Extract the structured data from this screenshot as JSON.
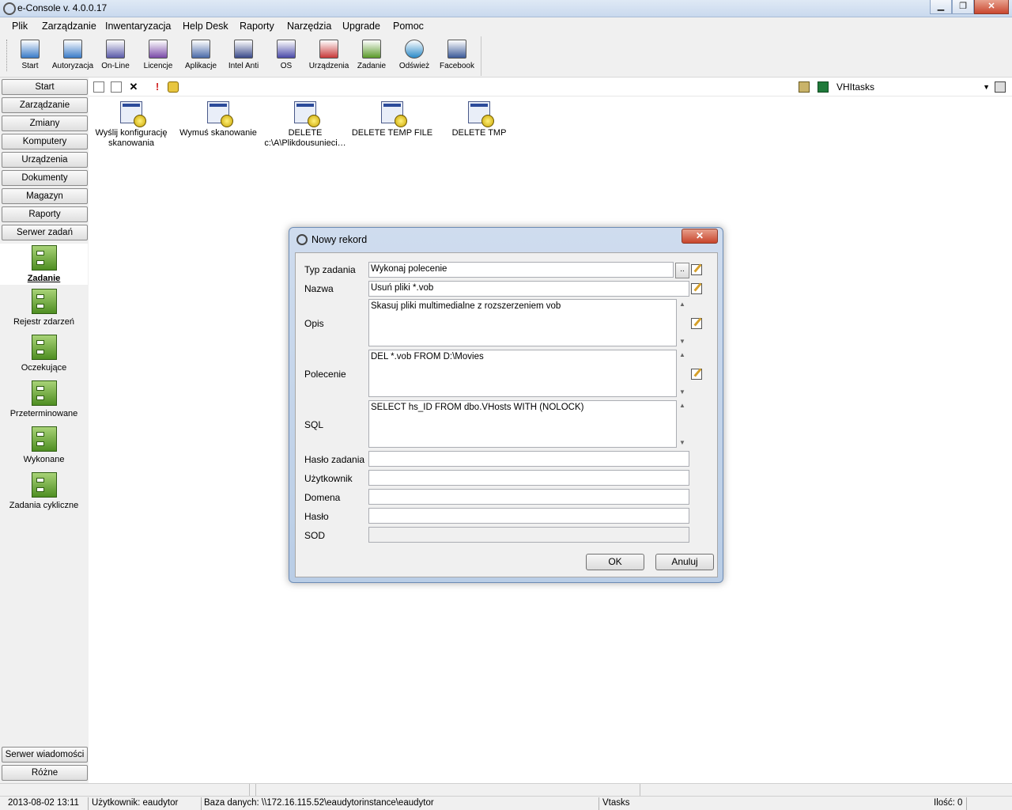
{
  "window": {
    "title": "e-Console v. 4.0.0.17",
    "minimize": "▁",
    "restore": "❐",
    "close": "✕"
  },
  "menu": [
    "Plik",
    "Zarządzanie",
    "Inwentaryzacja",
    "Help Desk",
    "Raporty",
    "Narzędzia",
    "Upgrade",
    "Pomoc"
  ],
  "toolbar": [
    {
      "label": "Start",
      "icon": "start-icon",
      "color": "#3a7bc8"
    },
    {
      "label": "Autoryzacja",
      "icon": "authorization-icon",
      "color": "#3a7bc8"
    },
    {
      "label": "On-Line",
      "icon": "online-icon",
      "color": "#5a5aa8"
    },
    {
      "label": "Licencje",
      "icon": "licenses-icon",
      "color": "#7a4aa8"
    },
    {
      "label": "Aplikacje",
      "icon": "applications-icon",
      "color": "#4a6aa8"
    },
    {
      "label": "Intel Anti",
      "icon": "intel-anti-icon",
      "color": "#3a4a8a"
    },
    {
      "label": "OS",
      "icon": "os-icon",
      "color": "#4a4aa8"
    },
    {
      "label": "Urządzenia",
      "icon": "devices-icon",
      "color": "#c83a3a"
    },
    {
      "label": "Zadanie",
      "icon": "task-icon",
      "color": "#5a9a2a"
    },
    {
      "label": "Odśwież",
      "icon": "refresh-icon",
      "color": "#2a8ac8"
    },
    {
      "label": "Facebook",
      "icon": "facebook-icon",
      "color": "#3b5998"
    }
  ],
  "sidebar": {
    "nav": [
      "Start",
      "Zarządzanie",
      "Zmiany",
      "Komputery",
      "Urządzenia",
      "Dokumenty",
      "Magazyn",
      "Raporty",
      "Serwer zadań"
    ],
    "items": [
      {
        "label": "Zadanie",
        "icon": "task-list-icon",
        "active": true
      },
      {
        "label": "Rejestr zdarzeń",
        "icon": "event-log-icon"
      },
      {
        "label": "Oczekujące",
        "icon": "pending-icon"
      },
      {
        "label": "Przeterminowane",
        "icon": "expired-icon"
      },
      {
        "label": "Wykonane",
        "icon": "completed-icon"
      },
      {
        "label": "Zadania cykliczne",
        "icon": "recurring-tasks-icon"
      }
    ],
    "bottom": [
      "Serwer wiadomości",
      "Różne"
    ]
  },
  "content_toolbar": {
    "combo_value": "VHItasks"
  },
  "tasks": [
    {
      "line1": "Wyślij konfigurację",
      "line2": "skanowania"
    },
    {
      "line1": "Wymuś skanowanie",
      "line2": ""
    },
    {
      "line1": "DELETE",
      "line2": "c:\\A\\Plikdousunieci…"
    },
    {
      "line1": "DELETE TEMP FILE",
      "line2": ""
    },
    {
      "line1": "DELETE TMP",
      "line2": ""
    }
  ],
  "dialog": {
    "title": "Nowy rekord",
    "close": "✕",
    "fields": {
      "typ": {
        "label": "Typ zadania",
        "value": "Wykonaj polecenie"
      },
      "nazwa": {
        "label": "Nazwa",
        "value": "Usuń pliki *.vob"
      },
      "opis": {
        "label": "Opis",
        "value": "Skasuj pliki multimedialne z rozszerzeniem vob"
      },
      "polecenie": {
        "label": "Polecenie",
        "value": "DEL *.vob FROM D:\\Movies"
      },
      "sql": {
        "label": "SQL",
        "value": "SELECT hs_ID FROM dbo.VHosts WITH (NOLOCK)"
      },
      "haslo_zadania": {
        "label": "Hasło zadania",
        "value": ""
      },
      "uzytkownik": {
        "label": "Użytkownik",
        "value": ""
      },
      "domena": {
        "label": "Domena",
        "value": ""
      },
      "haslo": {
        "label": "Hasło",
        "value": ""
      },
      "sod": {
        "label": "SOD",
        "value": ""
      }
    },
    "ellipsis": "..",
    "ok": "OK",
    "cancel": "Anuluj"
  },
  "status": {
    "datetime": "2013-08-02  13:11",
    "user": "Użytkownik: eaudytor",
    "database": "Baza danych: \\\\172.16.115.52\\eaudytorinstance\\eaudytor",
    "module": "Vtasks",
    "count": "Ilość: 0"
  }
}
